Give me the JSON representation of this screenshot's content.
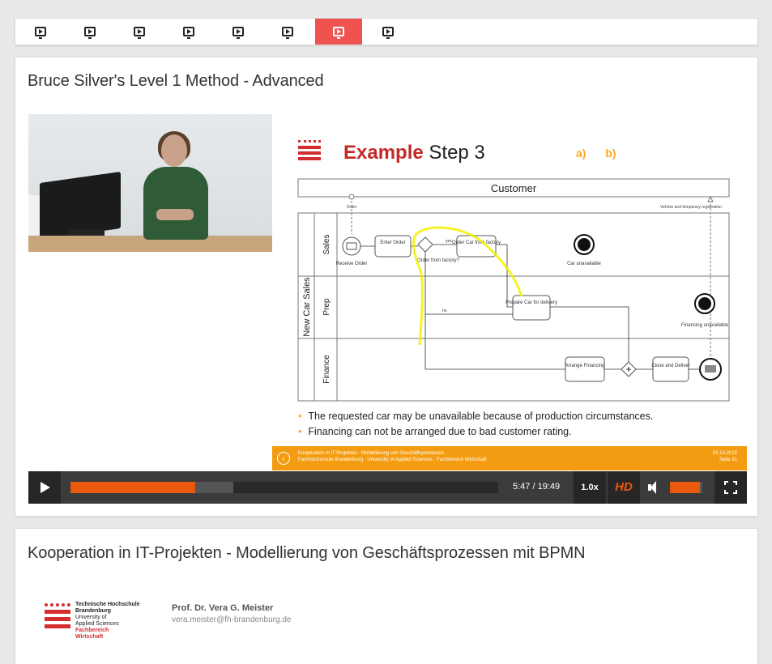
{
  "tabs": [
    {
      "icon": "presentation-icon",
      "active": false
    },
    {
      "icon": "presentation-icon",
      "active": false
    },
    {
      "icon": "presentation-icon",
      "active": false
    },
    {
      "icon": "presentation-icon",
      "active": false
    },
    {
      "icon": "presentation-icon",
      "active": false
    },
    {
      "icon": "presentation-icon",
      "active": false
    },
    {
      "icon": "presentation-icon",
      "active": true
    },
    {
      "icon": "presentation-icon",
      "active": false
    }
  ],
  "video": {
    "title": "Bruce Silver's Level 1 Method - Advanced",
    "slide": {
      "title_highlight": "Example",
      "title_rest": "Step 3",
      "options": [
        "a)",
        "b)"
      ],
      "diagram": {
        "pool_top": "Customer",
        "pool_main": "New Car Sales",
        "lanes": [
          "Sales",
          "Prep",
          "Finance"
        ],
        "labels": {
          "order": "Order",
          "vehicle_reg": "Vehicle and temporary registration",
          "receive_order": "Receive Order",
          "enter_order": "Enter Order",
          "gateway": "Order from factory?",
          "yes": "yes",
          "no": "no",
          "order_car": "Order Car from factory",
          "car_unavailable": "Car unavailable",
          "prepare_car": "Prepare Car for delivery",
          "financing_unavailable": "Financing unavailable",
          "arrange_financing": "Arrange Financing",
          "close_deliver": "Close and Deliver"
        }
      },
      "bullets": [
        "The requested car may be unavailable because of production circumstances.",
        "Financing can not be arranged due to bad customer rating."
      ],
      "footer_line1": "Kooperation in IT-Projekten · Modellierung von Geschäftsprozessen",
      "footer_line2": "Fachhochschule Brandenburg · University of Applied Sciences · Fachbereich Wirtschaft",
      "footer_date": "02.10.2015",
      "footer_page": "Seite 31"
    },
    "player": {
      "time": "5:47 / 19:49",
      "speed": "1.0x",
      "hd": "HD",
      "progress": 0.292,
      "buffered": 0.38,
      "volume": 0.92
    }
  },
  "course": {
    "title": "Kooperation in IT-Projekten - Modellierung von Geschäftsprozessen mit BPMN",
    "university": {
      "line1": "Technische Hochschule",
      "line2": "Brandenburg",
      "line3": "University of",
      "line4": "Applied Sciences",
      "line5": "Fachbereich",
      "line6": "Wirtschaft"
    },
    "author_name": "Prof. Dr. Vera G. Meister",
    "author_email": "vera.meister@fh-brandenburg.de"
  },
  "colors": {
    "accent": "#ef5350",
    "orange": "#e8590c",
    "slide_red": "#c62828",
    "slide_yellow": "#f9a825"
  }
}
